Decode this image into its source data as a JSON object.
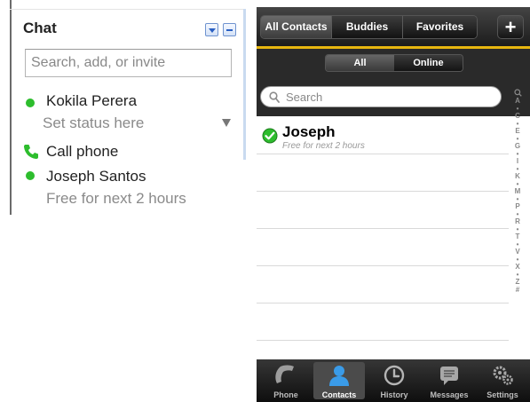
{
  "chat": {
    "title": "Chat",
    "search_placeholder": "Search, add, or invite",
    "me": {
      "name": "Kokila Perera",
      "status": "Set status here"
    },
    "call_phone_label": "Call phone",
    "contact": {
      "name": "Joseph Santos",
      "status": "Free for next 2 hours"
    },
    "colors": {
      "online": "#2dbd2d",
      "phone": "#2dbd2d",
      "control": "#2a5fc2"
    },
    "icons": {
      "dropdown": "chevron-down-icon",
      "minimize": "minus-icon",
      "status_menu": "caret-down-icon",
      "phone": "phone-icon"
    }
  },
  "iphone": {
    "top_tabs": [
      {
        "label": "All Contacts",
        "active": true
      },
      {
        "label": "Buddies",
        "active": false
      },
      {
        "label": "Favorites",
        "active": false
      }
    ],
    "add_label": "+",
    "filter_tabs": [
      {
        "label": "All",
        "active": true
      },
      {
        "label": "Online",
        "active": false
      }
    ],
    "search_placeholder": "Search",
    "index_letters": [
      "A",
      "•",
      "C",
      "•",
      "E",
      "•",
      "G",
      "•",
      "I",
      "•",
      "K",
      "•",
      "M",
      "•",
      "P",
      "•",
      "R",
      "•",
      "T",
      "•",
      "V",
      "•",
      "X",
      "•",
      "Z",
      "#"
    ],
    "contacts": [
      {
        "name": "Joseph",
        "status": "Free for next 2 hours",
        "online": true
      }
    ],
    "bottom_tabs": [
      {
        "label": "Phone",
        "icon": "phone-handset-icon",
        "active": false
      },
      {
        "label": "Contacts",
        "icon": "person-icon",
        "active": true
      },
      {
        "label": "History",
        "icon": "clock-icon",
        "active": false
      },
      {
        "label": "Messages",
        "icon": "message-bubble-icon",
        "active": false
      },
      {
        "label": "Settings",
        "icon": "gears-icon",
        "active": false
      }
    ],
    "colors": {
      "accent_rule": "#e7b60f",
      "online_check": "#2dbd2d"
    }
  }
}
